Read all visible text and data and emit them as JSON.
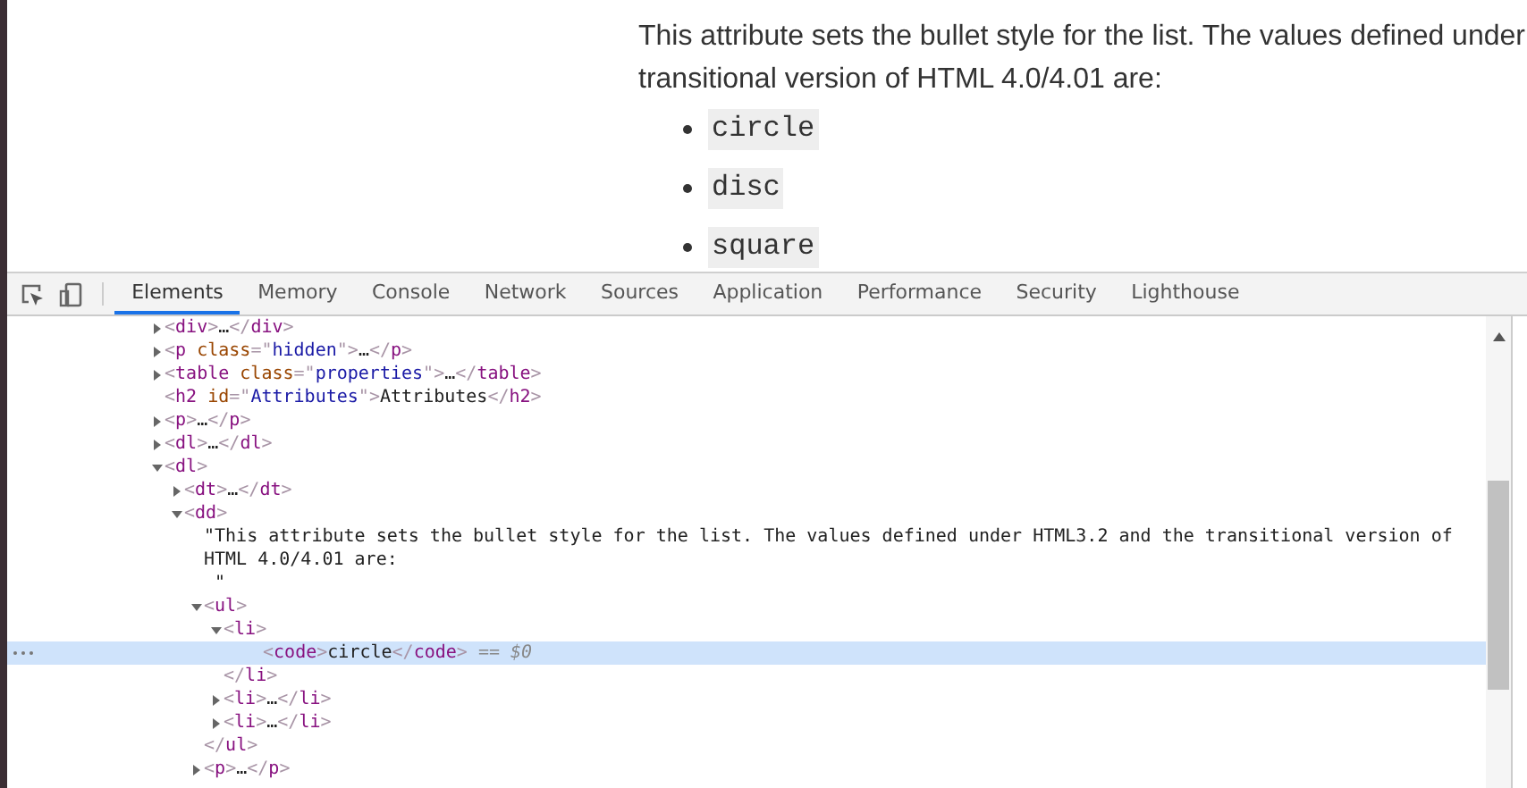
{
  "page": {
    "paragraph_lines": [
      "This attribute sets the bullet style for the list. The values defined under",
      "transitional version of HTML 4.0/4.01 are:"
    ],
    "values": [
      "circle",
      "disc",
      "square"
    ]
  },
  "devtools": {
    "tabs": [
      {
        "label": "Elements",
        "selected": true
      },
      {
        "label": "Memory",
        "selected": false
      },
      {
        "label": "Console",
        "selected": false
      },
      {
        "label": "Network",
        "selected": false
      },
      {
        "label": "Sources",
        "selected": false
      },
      {
        "label": "Application",
        "selected": false
      },
      {
        "label": "Performance",
        "selected": false
      },
      {
        "label": "Security",
        "selected": false
      },
      {
        "label": "Lighthouse",
        "selected": false
      }
    ],
    "tree": [
      {
        "kind": "element",
        "line": "<div>…</div>",
        "expandable": true,
        "expanded": false,
        "selected": false
      },
      {
        "kind": "element",
        "line": "<p class=\"hidden\">…</p>",
        "expandable": true,
        "expanded": false,
        "selected": false
      },
      {
        "kind": "element",
        "line": "<table class=\"properties\">…</table>",
        "expandable": true,
        "expanded": false,
        "selected": false
      },
      {
        "kind": "element",
        "line": "<h2 id=\"Attributes\">Attributes</h2>",
        "expandable": false,
        "selected": false
      },
      {
        "kind": "element",
        "line": "<p>…</p>",
        "expandable": true,
        "expanded": false,
        "selected": false
      },
      {
        "kind": "element",
        "line": "<dl>…</dl>",
        "expandable": true,
        "expanded": false,
        "selected": false
      },
      {
        "kind": "element",
        "line": "<dl>",
        "expandable": true,
        "expanded": true,
        "selected": false,
        "children": [
          {
            "kind": "element",
            "line": "<dt>…</dt>",
            "expandable": true,
            "expanded": false,
            "selected": false
          },
          {
            "kind": "element",
            "line": "<dd>",
            "expandable": true,
            "expanded": true,
            "selected": false,
            "children": [
              {
                "kind": "text",
                "lines": [
                  "\"This attribute sets the bullet style for the list. The values defined under HTML3.2 and the transitional version of",
                  "HTML 4.0/4.01 are:",
                  " \""
                ]
              },
              {
                "kind": "element",
                "line": "<ul>",
                "expandable": true,
                "expanded": true,
                "selected": false,
                "close": "</ul>",
                "children": [
                  {
                    "kind": "element",
                    "line": "<li>",
                    "expandable": true,
                    "expanded": true,
                    "selected": false,
                    "close": "</li>",
                    "children": [
                      {
                        "kind": "element",
                        "line": "<code>circle</code>",
                        "expandable": false,
                        "selected": true,
                        "console_ref": "== $0"
                      }
                    ]
                  },
                  {
                    "kind": "element",
                    "line": "<li>…</li>",
                    "expandable": true,
                    "expanded": false,
                    "selected": false
                  },
                  {
                    "kind": "element",
                    "line": "<li>…</li>",
                    "expandable": true,
                    "expanded": false,
                    "selected": false
                  }
                ]
              },
              {
                "kind": "element",
                "line": "<p>…</p>",
                "expandable": true,
                "expanded": false,
                "selected": false
              }
            ]
          }
        ]
      }
    ]
  }
}
